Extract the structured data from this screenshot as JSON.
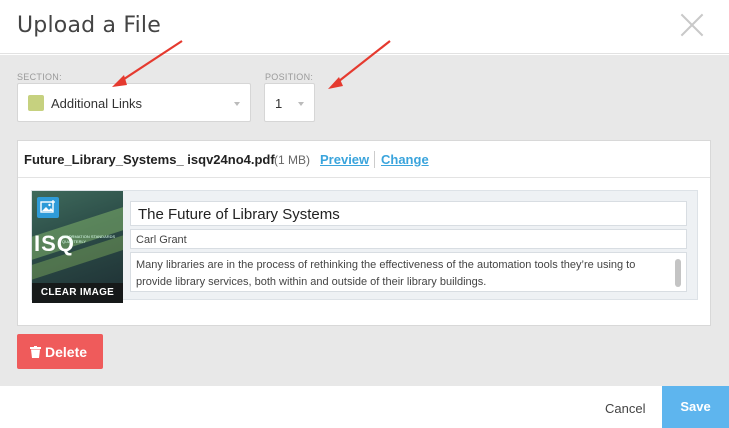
{
  "header": {
    "title": "Upload a File"
  },
  "section": {
    "label": "SECTION:",
    "value": "Additional Links",
    "swatch_color": "#c6d17f"
  },
  "position": {
    "label": "POSITION:",
    "value": "1"
  },
  "file": {
    "name": "Future_Library_Systems_ isqv24no4.pdf",
    "size": "(1 MB)",
    "preview_label": "Preview",
    "change_label": "Change",
    "clear_image_label": "CLEAR IMAGE",
    "title": "The Future of Library Systems",
    "author": "Carl Grant",
    "description": "Many libraries are in the process of rethinking the effectiveness of the automation tools they’re using to provide library services, both within and outside of their library buildings.",
    "thumbnail_text": "ISQ",
    "thumbnail_subtext": "INFORMATION STANDARDS QUARTERLY"
  },
  "actions": {
    "delete_label": "Delete",
    "cancel_label": "Cancel",
    "save_label": "Save"
  },
  "colors": {
    "link": "#3aa4dc",
    "delete": "#ef5b5b",
    "save": "#5eb5ee",
    "annotation_arrow": "#e53a2f"
  },
  "icons": {
    "close": "close-icon",
    "image": "image-icon",
    "trash": "trash-icon",
    "caret": "caret-down-icon"
  }
}
